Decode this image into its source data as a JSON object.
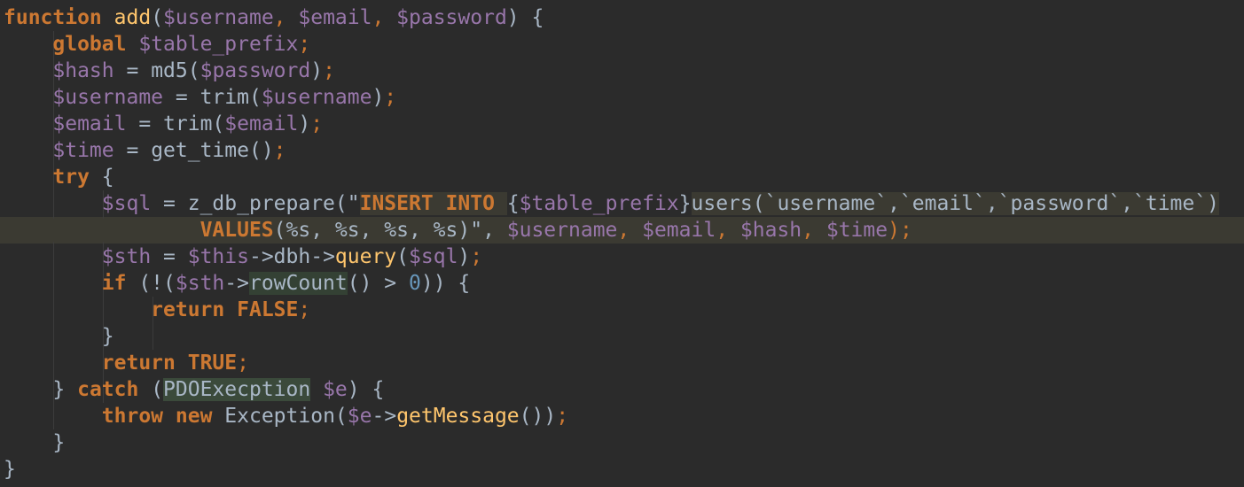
{
  "editor": {
    "theme_colors": {
      "background": "#2b2b2b",
      "keyword": "#cc7832",
      "variable": "#9876aa",
      "function": "#ffc66d",
      "string": "#6a8759",
      "number": "#6897bb",
      "text": "#a9b7c6"
    },
    "lines": [
      {
        "t": [
          [
            "function",
            "kw"
          ],
          [
            " ",
            ""
          ],
          [
            "add",
            "fn"
          ],
          [
            "(",
            ""
          ],
          [
            "$username",
            "var"
          ],
          [
            ", ",
            "pu"
          ],
          [
            "$email",
            "var"
          ],
          [
            ", ",
            "pu"
          ],
          [
            "$password",
            "var"
          ],
          [
            ") {",
            ""
          ]
        ]
      },
      {
        "t": [
          [
            "    ",
            ""
          ],
          [
            "global",
            "kw"
          ],
          [
            " ",
            ""
          ],
          [
            "$table_prefix",
            "var"
          ],
          [
            ";",
            "pu"
          ]
        ]
      },
      {
        "t": [
          [
            "    ",
            ""
          ],
          [
            "$hash",
            "var"
          ],
          [
            " = ",
            ""
          ],
          [
            "md5",
            ""
          ],
          [
            "(",
            ""
          ],
          [
            "$password",
            "var"
          ],
          [
            ")",
            ""
          ],
          [
            ";",
            "pu"
          ]
        ]
      },
      {
        "t": [
          [
            "    ",
            ""
          ],
          [
            "$username",
            "var"
          ],
          [
            " = ",
            ""
          ],
          [
            "trim",
            ""
          ],
          [
            "(",
            ""
          ],
          [
            "$username",
            "var"
          ],
          [
            ")",
            ""
          ],
          [
            ";",
            "pu"
          ]
        ]
      },
      {
        "t": [
          [
            "    ",
            ""
          ],
          [
            "$email",
            "var"
          ],
          [
            " = ",
            ""
          ],
          [
            "trim",
            ""
          ],
          [
            "(",
            ""
          ],
          [
            "$email",
            "var"
          ],
          [
            ")",
            ""
          ],
          [
            ";",
            "pu"
          ]
        ]
      },
      {
        "t": [
          [
            "    ",
            ""
          ],
          [
            "$time",
            "var"
          ],
          [
            " = ",
            ""
          ],
          [
            "get_time",
            ""
          ],
          [
            "()",
            ""
          ],
          [
            ";",
            "pu"
          ]
        ]
      },
      {
        "t": [
          [
            "    ",
            ""
          ],
          [
            "try",
            "kw"
          ],
          [
            " {",
            ""
          ]
        ]
      },
      {
        "t": [
          [
            "        ",
            ""
          ],
          [
            "$sql",
            "var"
          ],
          [
            " = ",
            ""
          ],
          [
            "z_db_prepare",
            ""
          ],
          [
            "(\"",
            ""
          ],
          [
            "INSERT INTO",
            "sqlkw"
          ],
          [
            " ",
            "sqlbg"
          ],
          [
            "{",
            ""
          ],
          [
            "$table_prefix",
            "var"
          ],
          [
            "}",
            ""
          ],
          [
            "users(`username`,`email`,`password`,`time`)",
            "sqlbg"
          ]
        ],
        "hl": false
      },
      {
        "t": [
          [
            "                ",
            "sqlbg"
          ],
          [
            "VALUES",
            "sqlkw"
          ],
          [
            "(%s, %s, %s, %s)",
            "sqlbg"
          ],
          [
            "\", ",
            ""
          ],
          [
            "$username",
            "var"
          ],
          [
            ", ",
            "pu"
          ],
          [
            "$email",
            "var"
          ],
          [
            ", ",
            "pu"
          ],
          [
            "$hash",
            "var"
          ],
          [
            ", ",
            "pu"
          ],
          [
            "$time",
            "var"
          ],
          [
            ");",
            "pu"
          ]
        ],
        "hl": true
      },
      {
        "t": [
          [
            "        ",
            ""
          ],
          [
            "$sth",
            "var"
          ],
          [
            " = ",
            ""
          ],
          [
            "$this",
            "var"
          ],
          [
            "->",
            ""
          ],
          [
            "dbh",
            ""
          ],
          [
            "->",
            ""
          ],
          [
            "query",
            "fn"
          ],
          [
            "(",
            ""
          ],
          [
            "$sql",
            "var"
          ],
          [
            ")",
            ""
          ],
          [
            ";",
            "pu"
          ]
        ]
      },
      {
        "t": [
          [
            "        ",
            ""
          ],
          [
            "if",
            "kw"
          ],
          [
            " (!(",
            ""
          ],
          [
            "$sth",
            "var"
          ],
          [
            "->",
            ""
          ],
          [
            "rowCount",
            "hlword"
          ],
          [
            "() > ",
            ""
          ],
          [
            "0",
            "num"
          ],
          [
            ")) {",
            ""
          ]
        ]
      },
      {
        "t": [
          [
            "            ",
            ""
          ],
          [
            "return",
            "kw"
          ],
          [
            " ",
            ""
          ],
          [
            "FALSE",
            "kw"
          ],
          [
            ";",
            "pu"
          ]
        ]
      },
      {
        "t": [
          [
            "        }",
            ""
          ]
        ]
      },
      {
        "t": [
          [
            "        ",
            ""
          ],
          [
            "return",
            "kw"
          ],
          [
            " ",
            ""
          ],
          [
            "TRUE",
            "kw"
          ],
          [
            ";",
            "pu"
          ]
        ]
      },
      {
        "t": [
          [
            "    } ",
            ""
          ],
          [
            "catch",
            "kw"
          ],
          [
            " (",
            ""
          ],
          [
            "PDOExecption",
            "hlclass"
          ],
          [
            " ",
            ""
          ],
          [
            "$e",
            "var"
          ],
          [
            ") {",
            ""
          ]
        ]
      },
      {
        "t": [
          [
            "        ",
            ""
          ],
          [
            "throw",
            "kw"
          ],
          [
            " ",
            ""
          ],
          [
            "new",
            "kw"
          ],
          [
            " ",
            ""
          ],
          [
            "Exception",
            ""
          ],
          [
            "(",
            ""
          ],
          [
            "$e",
            "var"
          ],
          [
            "->",
            ""
          ],
          [
            "getMessage",
            "fn"
          ],
          [
            "())",
            ""
          ],
          [
            ";",
            "pu"
          ]
        ]
      },
      {
        "t": [
          [
            "    }",
            ""
          ]
        ]
      },
      {
        "t": [
          [
            "}",
            ""
          ]
        ]
      }
    ]
  }
}
